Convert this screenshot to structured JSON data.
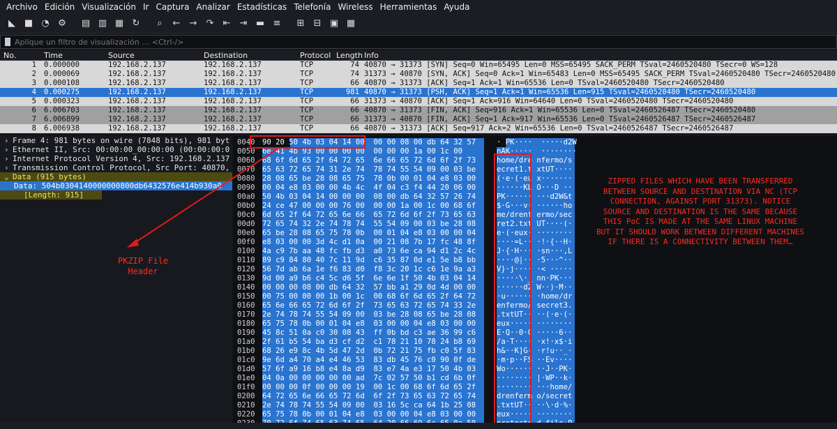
{
  "menu": [
    "Archivo",
    "Edición",
    "Visualización",
    "Ir",
    "Captura",
    "Analizar",
    "Estadísticas",
    "Telefonía",
    "Wireless",
    "Herramientas",
    "Ayuda"
  ],
  "filter": {
    "placeholder": "Aplique un filtro de visualización … <Ctrl-/>"
  },
  "columns": {
    "no": "No.",
    "time": "Time",
    "source": "Source",
    "destination": "Destination",
    "protocol": "Protocol",
    "length": "Length",
    "info": "Info"
  },
  "packets": [
    {
      "no": "1",
      "time": "0.000000",
      "src": "192.168.2.137",
      "dst": "192.168.2.137",
      "proto": "TCP",
      "len": "74",
      "info": "40870 → 31373 [SYN] Seq=0 Win=65495 Len=0 MSS=65495 SACK_PERM TSval=2460520480 TSecr=0 WS=128"
    },
    {
      "no": "2",
      "time": "0.000069",
      "src": "192.168.2.137",
      "dst": "192.168.2.137",
      "proto": "TCP",
      "len": "74",
      "info": "31373 → 40870 [SYN, ACK] Seq=0 Ack=1 Win=65483 Len=0 MSS=65495 SACK_PERM TSval=2460520480 TSecr=2460520480"
    },
    {
      "no": "3",
      "time": "0.000108",
      "src": "192.168.2.137",
      "dst": "192.168.2.137",
      "proto": "TCP",
      "len": "66",
      "info": "40870 → 31373 [ACK] Seq=1 Ack=1 Win=65536 Len=0 TSval=2460520480 TSecr=2460520480"
    },
    {
      "no": "4",
      "time": "0.000275",
      "src": "192.168.2.137",
      "dst": "192.168.2.137",
      "proto": "TCP",
      "len": "981",
      "info": "40870 → 31373 [PSH, ACK] Seq=1 Ack=1 Win=65536 Len=915 TSval=2460520480 TSecr=2460520480"
    },
    {
      "no": "5",
      "time": "0.000323",
      "src": "192.168.2.137",
      "dst": "192.168.2.137",
      "proto": "TCP",
      "len": "66",
      "info": "31373 → 40870 [ACK] Seq=1 Ack=916 Win=64640 Len=0 TSval=2460520480 TSecr=2460520480"
    },
    {
      "no": "6",
      "time": "6.006703",
      "src": "192.168.2.137",
      "dst": "192.168.2.137",
      "proto": "TCP",
      "len": "66",
      "info": "40870 → 31373 [FIN, ACK] Seq=916 Ack=1 Win=65536 Len=0 TSval=2460526487 TSecr=2460520480"
    },
    {
      "no": "7",
      "time": "6.006899",
      "src": "192.168.2.137",
      "dst": "192.168.2.137",
      "proto": "TCP",
      "len": "66",
      "info": "31373 → 40870 [FIN, ACK] Seq=1 Ack=917 Win=65536 Len=0 TSval=2460526487 TSecr=2460526487"
    },
    {
      "no": "8",
      "time": "6.006938",
      "src": "192.168.2.137",
      "dst": "192.168.2.137",
      "proto": "TCP",
      "len": "66",
      "info": "40870 → 31373 [ACK] Seq=917 Ack=2 Win=65536 Len=0 TSval=2460526487 TSecr=2460526487"
    }
  ],
  "details": [
    "Frame 4: 981 bytes on wire (7848 bits), 981 byt",
    "Ethernet II, Src: 00:00:00_00:00:00 (00:00:00:0",
    "Internet Protocol Version 4, Src: 192.168.2.137",
    "Transmission Control Protocol, Src Port: 40870,",
    "Data (915 bytes)",
    "Data: 504b0304140000000800db6432576e414b930a0",
    "[Length: 915]"
  ],
  "hex": [
    {
      "off": "0040",
      "bytes": "90 20 50 4b 03 04 14 00  00 00 08 00 db 64 32 57",
      "ascii": "· PK····  ·····d2W"
    },
    {
      "off": "0050",
      "bytes": "6e 41 4b 93 00 00 00 00  00 00 00 1a 00 1c 00",
      "ascii": "nAK·····  ········"
    },
    {
      "off": "0060",
      "bytes": "68 6f 6d 65 2f 64 72 65  6e 66 65 72 6d 6f 2f 73",
      "ascii": "home/dre nfermo/s"
    },
    {
      "off": "0070",
      "bytes": "65 63 72 65 74 31 2e 74  78 74 55 54 09 00 03 be",
      "ascii": "ecret1.t xtUT····"
    },
    {
      "off": "0080",
      "bytes": "28 08 65 be 28 08 65 75  78 0b 00 01 04 e8 03 00",
      "ascii": "(·e·(·eu x·······"
    },
    {
      "off": "0090",
      "bytes": "00 04 e8 03 00 00 4b 4c  4f 04 c3 f4 44 20 06 00",
      "ascii": "······KL O···D ··"
    },
    {
      "off": "00a0",
      "bytes": "50 4b 03 04 14 00 00 00  08 00 db 64 32 57 26 74",
      "ascii": "PK······ ···d2W&t"
    },
    {
      "off": "00b0",
      "bytes": "24 ce 47 00 00 00 76 00  00 00 1a 00 1c 00 68 6f",
      "ascii": "$·G···v· ······ho"
    },
    {
      "off": "00c0",
      "bytes": "6d 65 2f 64 72 65 6e 66  65 72 6d 6f 2f 73 65 63",
      "ascii": "me/drenf ermo/sec"
    },
    {
      "off": "00d0",
      "bytes": "72 65 74 32 2e 74 78 74  55 54 09 00 03 be 28 08",
      "ascii": "ret2.txt UT····(·"
    },
    {
      "off": "00e0",
      "bytes": "65 be 28 08 65 75 78 0b  00 01 04 e8 03 00 00 04",
      "ascii": "e·(·eux· ········"
    },
    {
      "off": "00f0",
      "bytes": "e8 03 00 00 3d 4c d1 0a  00 21 08 7b 17 fc 48 8f",
      "ascii": "····=L·· ·!·{··H·"
    },
    {
      "off": "0100",
      "bytes": "4a c9 7b aa 48 fc fb d3  a0 73 6e ca 94 d1 2c 4c",
      "ascii": "J·{·H··· ·sn···,L"
    },
    {
      "off": "0110",
      "bytes": "89 c9 84 80 40 7c 11 9d  c6 35 87 0d e1 5e b8 bb",
      "ascii": "····@|·· ·5···^··"
    },
    {
      "off": "0120",
      "bytes": "56 7d ab 6a 1e f6 83 d0  f8 3c 20 1c c6 1e 9a a3",
      "ascii": "V}·j···· ·< ·····"
    },
    {
      "off": "0130",
      "bytes": "9d 00 a9 b6 c4 5c d6 5f  6e 6e 1f 50 4b 03 04 14",
      "ascii": "·····\\·_ nn·PK···"
    },
    {
      "off": "0140",
      "bytes": "00 00 00 08 00 db 64 32  57 bb a1 29 0d 4d 00 00",
      "ascii": "······d2 W··)·M··"
    },
    {
      "off": "0150",
      "bytes": "00 75 00 00 00 1b 00 1c  00 68 6f 6d 65 2f 64 72",
      "ascii": "·u······ ·home/dr"
    },
    {
      "off": "0160",
      "bytes": "65 6e 66 65 72 6d 6f 2f  73 65 63 72 65 74 33 2e",
      "ascii": "enfermo/ secret3."
    },
    {
      "off": "0170",
      "bytes": "2e 74 78 74 55 54 09 00  03 be 28 08 65 be 28 08",
      "ascii": ".txtUT·· ··(·e·(·"
    },
    {
      "off": "0180",
      "bytes": "65 75 78 0b 00 01 04 e8  03 00 00 04 e8 03 00 00",
      "ascii": "eux····· ········"
    },
    {
      "off": "0190",
      "bytes": "45 8c 51 0a c0 30 08 43  ff 0b bd c3 ae 36 99 c6",
      "ascii": "E·Q··0·C ·····6··"
    },
    {
      "off": "01a0",
      "bytes": "2f 61 b5 54 ba d3 cf d2  c1 78 21 10 78 24 b8 69",
      "ascii": "/a·T···· ·x!·x$·i"
    },
    {
      "off": "01b0",
      "bytes": "68 26 e9 8c 4b 5d 47 2d  0b 72 21 75 fb c0 5f 83",
      "ascii": "h&··K]G- ·r!u··_·"
    },
    {
      "off": "01c0",
      "bytes": "9e 6d a4 70 a4 e4 46 53  83 db 45 76 c0 90 0f de",
      "ascii": "·m·p··FS ··Ev····"
    },
    {
      "off": "01d0",
      "bytes": "57 6f a9 16 b8 e4 8a d9  83 e7 4a e3 17 50 4b 03",
      "ascii": "Wo······ ··J··PK·"
    },
    {
      "off": "01e0",
      "bytes": "04 0a 00 00 00 00 00 ad  7c 02 57 50 b1 cd 6b 0f",
      "ascii": "········ |·WP··k·"
    },
    {
      "off": "01f0",
      "bytes": "00 00 00 0f 00 00 00 19  00 1c 00 68 6f 6d 65 2f",
      "ascii": "········ ···home/"
    },
    {
      "off": "0200",
      "bytes": "64 72 65 6e 66 65 72 6d  6f 2f 73 65 63 72 65 74",
      "ascii": "drenferm o/secret"
    },
    {
      "off": "0210",
      "bytes": "2e 74 78 74 55 54 09 00  03 16 5c ca 64 1b 25 08",
      "ascii": ".txtUT·· ··\\·d·%·"
    },
    {
      "off": "0220",
      "bytes": "65 75 78 0b 00 01 04 e8  03 00 00 04 e8 03 00 00",
      "ascii": "eux····· ········"
    },
    {
      "off": "0230",
      "bytes": "70 72 6f 74 65 63 74 65  64 20 66 69 6c 65 0a 50",
      "ascii": "protecte d file·P"
    },
    {
      "off": "0240",
      "bytes": "4b 01 02 1e 03 14 00 00  00 08 00 db 64 32 57 6e",
      "ascii": "K······· ···d2Wn"
    }
  ],
  "annotations": {
    "pkzip": "PKZIP File Header",
    "note": "ZIPPED FILES WHICH HAVE BEEN TRANSFERRED BETWEEN SOURCE AND DESTINATION VIA NC (TCP CONNECTION, AGAINST PORT 31373). NOTICE SOURCE AND DESTINATION IS THE SAME BECAUSE THIS PoC IS MADE AT THE SAME LINUX MACHINE BUT IT SHOULD WORK BETWEEN DIFFERENT MACHINES IF THERE IS A CONNECTIVITY BETWEEN THEM…"
  },
  "colors": {
    "selected": "#2a74d0",
    "annotation": "#ff2a1f",
    "tcp_row": "#d8d8d8",
    "fin_row": "#a0a0a0"
  }
}
